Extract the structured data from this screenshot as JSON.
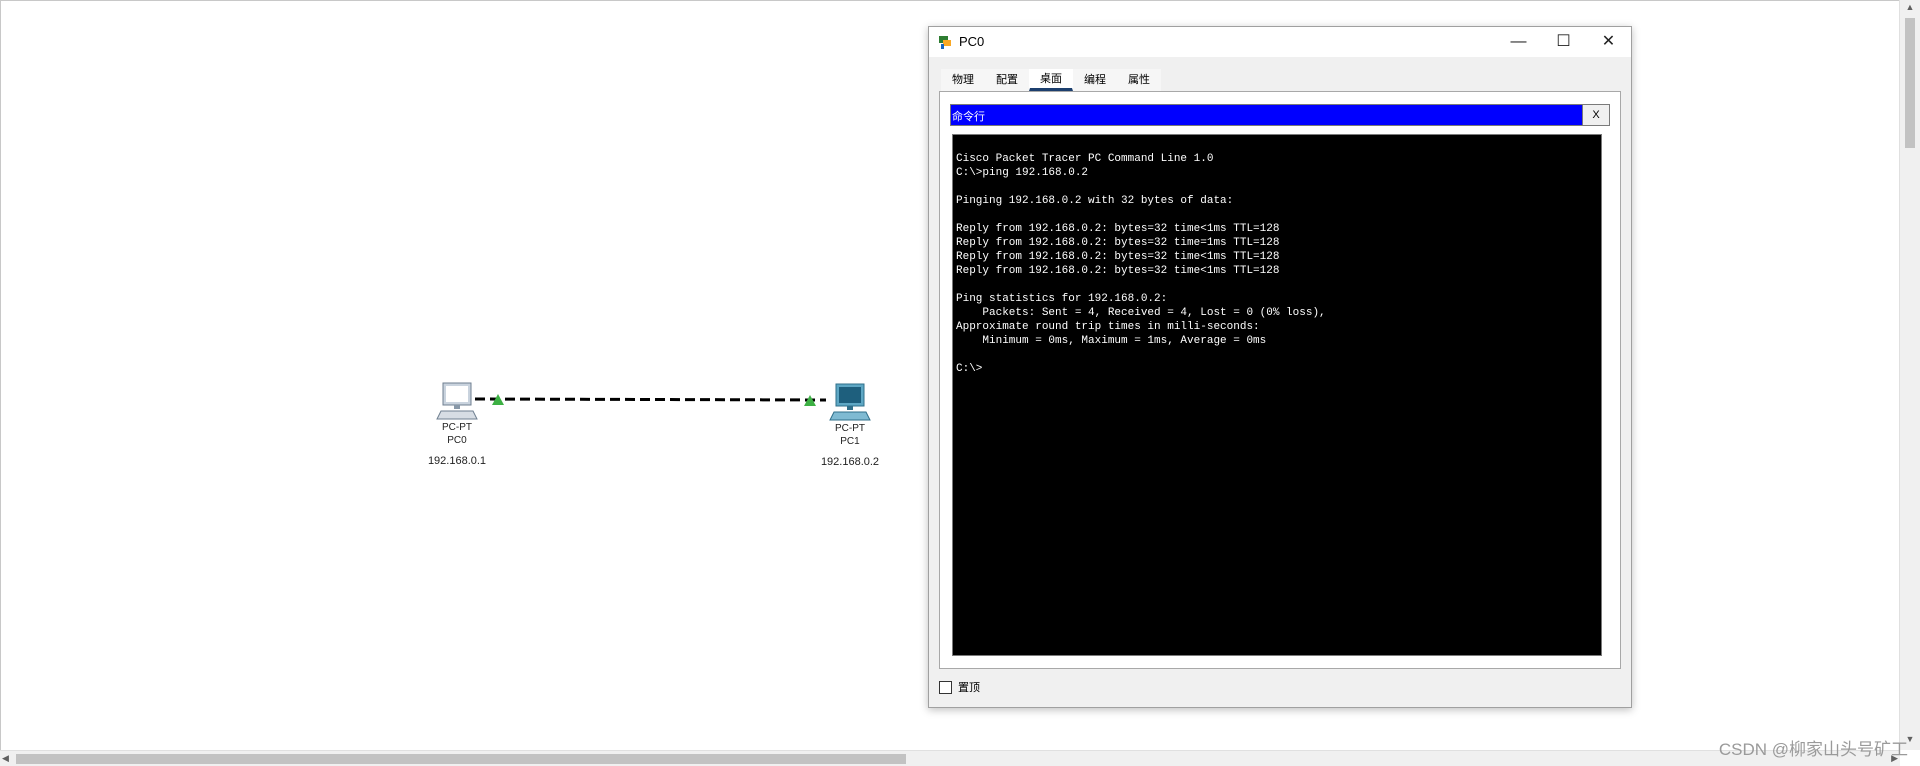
{
  "devices": [
    {
      "type": "PC-PT",
      "name": "PC0",
      "ip": "192.168.0.1"
    },
    {
      "type": "PC-PT",
      "name": "PC1",
      "ip": "192.168.0.2"
    }
  ],
  "window": {
    "title": "PC0",
    "tabs": [
      "物理",
      "配置",
      "桌面",
      "编程",
      "属性"
    ],
    "active_tab": "桌面",
    "cmd_title": "命令行",
    "cmd_close": "X",
    "terminal_lines": [
      "Cisco Packet Tracer PC Command Line 1.0",
      "C:\\>ping 192.168.0.2",
      "",
      "Pinging 192.168.0.2 with 32 bytes of data:",
      "",
      "Reply from 192.168.0.2: bytes=32 time<1ms TTL=128",
      "Reply from 192.168.0.2: bytes=32 time=1ms TTL=128",
      "Reply from 192.168.0.2: bytes=32 time<1ms TTL=128",
      "Reply from 192.168.0.2: bytes=32 time<1ms TTL=128",
      "",
      "Ping statistics for 192.168.0.2:",
      "    Packets: Sent = 4, Received = 4, Lost = 0 (0% loss),",
      "Approximate round trip times in milli-seconds:",
      "    Minimum = 0ms, Maximum = 1ms, Average = 0ms",
      "",
      "C:\\>"
    ],
    "topmost_label": "置顶"
  },
  "watermark": "CSDN @柳家山头号矿工",
  "colors": {
    "cmd_header": "#0000ff",
    "terminal_bg": "#000000",
    "link_up_triangle": "#3cb043"
  }
}
